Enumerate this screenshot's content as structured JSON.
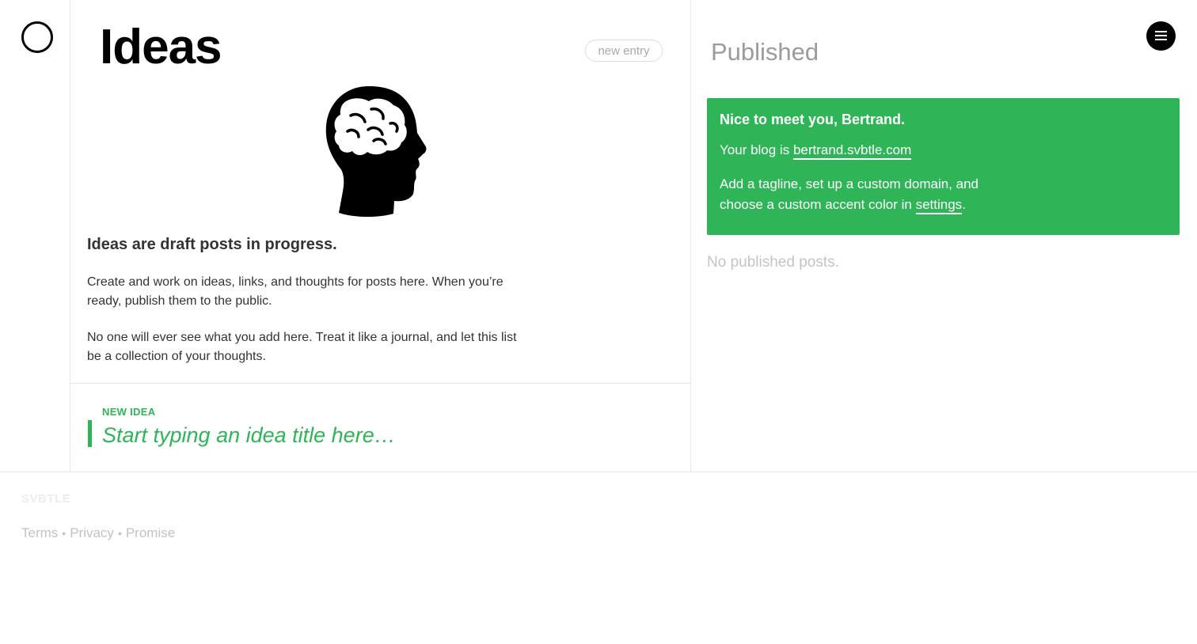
{
  "ideas": {
    "title": "Ideas",
    "new_entry_label": "new entry",
    "intro_heading": "Ideas are draft posts in progress.",
    "paragraph_1": "Create and work on ideas, links, and thoughts for posts here. When you’re ready, publish them to the public.",
    "paragraph_2": "No one will ever see what you add here. Treat it like a journal, and let this list be a collection of your thoughts.",
    "new_idea_label": "NEW IDEA",
    "idea_placeholder": "Start typing an idea title here…",
    "idea_value": ""
  },
  "published": {
    "title": "Published",
    "welcome": {
      "greeting": "Nice to meet you, Bertrand.",
      "blog_prefix": "Your blog is",
      "blog_url": "bertrand.svbtle.com",
      "text_prefix": "Add a tagline, set up a custom domain, and choose a custom accent color in",
      "settings_link": "settings",
      "text_suffix": "."
    },
    "empty_message": "No published posts."
  },
  "footer": {
    "brand": "SVBTLE",
    "links": [
      "Terms",
      "Privacy",
      "Promise"
    ],
    "separator": "•"
  },
  "icons": {
    "logo": "circle-logo-icon",
    "illustration": "brain-head-icon",
    "menu": "hamburger-menu-icon"
  },
  "colors": {
    "accent": "#2fb558",
    "muted": "#9b9b9b",
    "text": "#333333"
  }
}
